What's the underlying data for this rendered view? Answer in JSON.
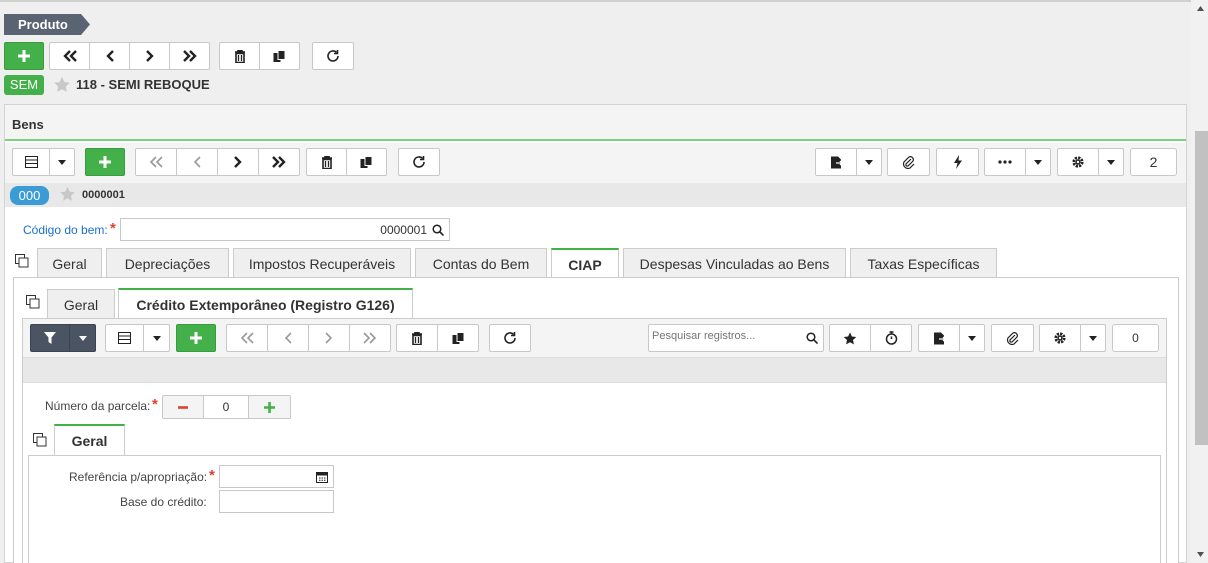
{
  "header": {
    "breadcrumb": "Produto",
    "badge": "SEM",
    "record_title": "118 - SEMI REBOQUE"
  },
  "bens": {
    "panel_title": "Bens",
    "badge": "000",
    "record_code": "0000001",
    "counter": "2",
    "field_codigo_label": "Código do bem:",
    "field_codigo_value": "0000001",
    "tabs": [
      {
        "label": "Geral"
      },
      {
        "label": "Depreciações"
      },
      {
        "label": "Impostos Recuperáveis"
      },
      {
        "label": "Contas do Bem"
      },
      {
        "label": "CIAP"
      },
      {
        "label": "Despesas Vinculadas ao Bens"
      },
      {
        "label": "Taxas Específicas"
      }
    ]
  },
  "ciap": {
    "subtabs": [
      {
        "label": "Geral"
      },
      {
        "label": "Crédito Extemporâneo (Registro G126)"
      }
    ],
    "search_placeholder": "Pesquisar registros...",
    "counter": "0",
    "parcela_label": "Número da parcela:",
    "parcela_value": "0",
    "inner_tab": "Geral",
    "ref_label": "Referência p/apropriação:",
    "base_label": "Base do crédito:"
  },
  "colors": {
    "accent": "#43b049",
    "blue": "#3b9bd4",
    "link": "#1a6fc9"
  }
}
